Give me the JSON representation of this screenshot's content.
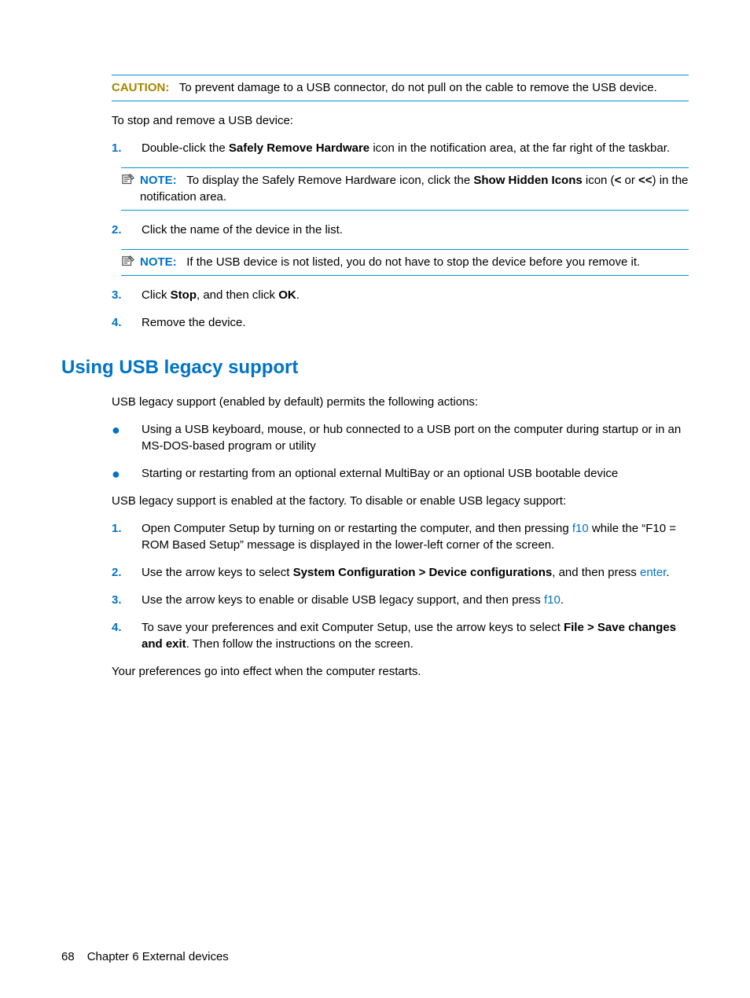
{
  "caution": {
    "label": "CAUTION:",
    "text": "To prevent damage to a USB connector, do not pull on the cable to remove the USB device."
  },
  "intro": "To stop and remove a USB device:",
  "steps1": {
    "s1": {
      "num": "1.",
      "pre": "Double-click the ",
      "bold": "Safely Remove Hardware",
      "post": " icon in the notification area, at the far right of the taskbar."
    },
    "note1": {
      "label": "NOTE:",
      "pre": "To display the Safely Remove Hardware icon, click the ",
      "bold1": "Show Hidden Icons",
      "mid": " icon (",
      "bold2": "<",
      "mid2": " or ",
      "bold3": "<<",
      "post": ") in the notification area."
    },
    "s2": {
      "num": "2.",
      "text": "Click the name of the device in the list."
    },
    "note2": {
      "label": "NOTE:",
      "text": "If the USB device is not listed, you do not have to stop the device before you remove it."
    },
    "s3": {
      "num": "3.",
      "pre": "Click ",
      "bold1": "Stop",
      "mid": ", and then click ",
      "bold2": "OK",
      "post": "."
    },
    "s4": {
      "num": "4.",
      "text": "Remove the device."
    }
  },
  "heading": "Using USB legacy support",
  "intro2": "USB legacy support (enabled by default) permits the following actions:",
  "bullets": {
    "b1": "Using a USB keyboard, mouse, or hub connected to a USB port on the computer during startup or in an MS-DOS-based program or utility",
    "b2": "Starting or restarting from an optional external MultiBay or an optional USB bootable device"
  },
  "intro3": "USB legacy support is enabled at the factory. To disable or enable USB legacy support:",
  "steps2": {
    "s1": {
      "num": "1.",
      "pre": "Open Computer Setup by turning on or restarting the computer, and then pressing ",
      "key": "f10",
      "post": " while the “F10 = ROM Based Setup” message is displayed in the lower-left corner of the screen."
    },
    "s2": {
      "num": "2.",
      "pre": "Use the arrow keys to select ",
      "bold": "System Configuration > Device configurations",
      "mid": ", and then press ",
      "key": "enter",
      "post": "."
    },
    "s3": {
      "num": "3.",
      "pre": "Use the arrow keys to enable or disable USB legacy support, and then press ",
      "key": "f10",
      "post": "."
    },
    "s4": {
      "num": "4.",
      "pre": "To save your preferences and exit Computer Setup, use the arrow keys to select ",
      "bold": "File > Save changes and exit",
      "post": ". Then follow the instructions on the screen."
    }
  },
  "outro": "Your preferences go into effect when the computer restarts.",
  "footer": {
    "page": "68",
    "chapter": "Chapter 6   External devices"
  }
}
